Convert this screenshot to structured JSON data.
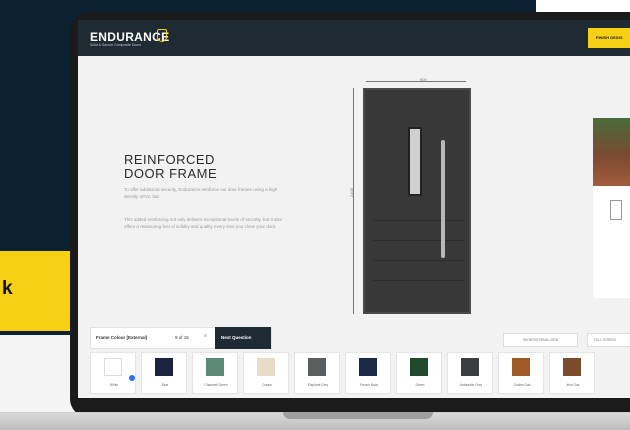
{
  "promo": {
    "text": "k"
  },
  "app": {
    "brand": "ENDURANCE",
    "brand_sub": "Solid & Secure Composite Doors",
    "finish_button": "FINISH DESIG"
  },
  "content": {
    "heading_line1": "REINFORCED",
    "heading_line2": "DOOR FRAME",
    "para1": "To offer additional security, Endurance reinforce our door frames using a high density uPVC bar.",
    "para2": "This added reinforcing not only delivers exceptional levels of security, but it also offers a reassuring feel of solidity and quality every time you close your door."
  },
  "door": {
    "width_label": "900",
    "height_label": "2100"
  },
  "controls": {
    "step_label": "Frame Colour (External)",
    "step_count": "9 of 15",
    "menu_icon": "≡",
    "next_button": "Next Question",
    "show_button": "SHOW INTERNAL VIEW",
    "full_button": "FULL SCREEN"
  },
  "swatches": [
    {
      "name": "White",
      "color": "#ffffff",
      "selected": true
    },
    {
      "name": "Blue",
      "color": "#1a2340"
    },
    {
      "name": "Chartwell Green",
      "color": "#5d8a78"
    },
    {
      "name": "Cream",
      "color": "#e8dcc6"
    },
    {
      "name": "Elephant Grey",
      "color": "#5a5e61"
    },
    {
      "name": "French Navy",
      "color": "#1c2a4a"
    },
    {
      "name": "Green",
      "color": "#1f4a2c"
    },
    {
      "name": "Anthracite Grey",
      "color": "#3a3d40"
    },
    {
      "name": "Golden Oak",
      "color": "#a05a28"
    },
    {
      "name": "Irish Oak",
      "color": "#7a4a2a"
    }
  ],
  "colors": {
    "accent": "#f7cf13",
    "header_bg": "#1e2b33",
    "page_bg": "#0b2233"
  }
}
